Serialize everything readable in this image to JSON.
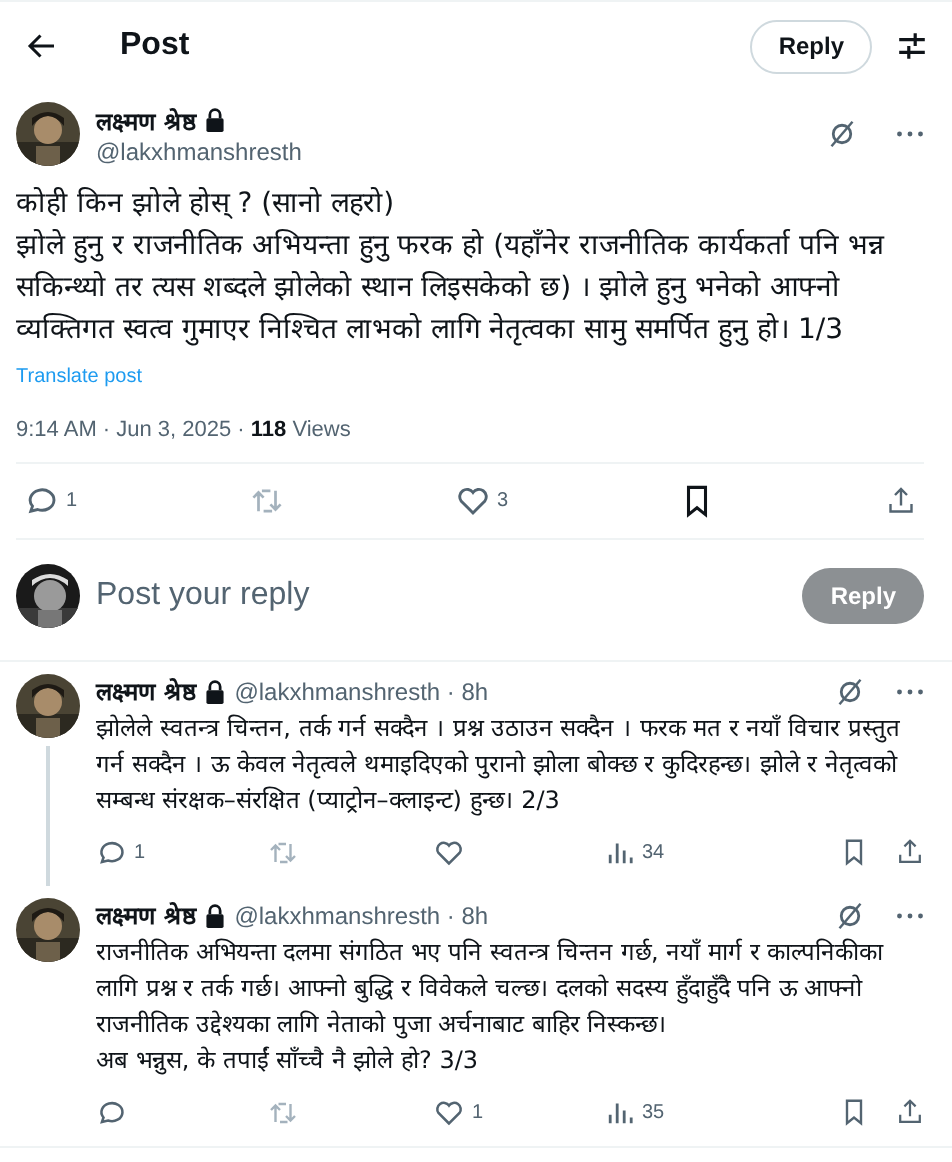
{
  "header": {
    "title": "Post",
    "reply_button": "Reply"
  },
  "post": {
    "author": {
      "name": "लक्ष्मण श्रेष्ठ",
      "handle": "@lakxhmanshresth",
      "locked": true
    },
    "paragraphs": [
      "कोही किन झोले होस् ? (सानो लहरो)",
      "झोले हुनु र राजनीतिक अभियन्ता हुनु फरक हो (यहाँनेर राजनीतिक कार्यकर्ता पनि भन्न सकिन्थ्यो तर त्यस शब्दले झोलेको स्थान लिइसकेको छ) । झोले हुनु भनेको आफ्नो व्यक्तिगत स्वत्व गुमाएर निश्चित लाभको लागि नेतृत्वका सामु समर्पित हुनु हो। 1/3"
    ],
    "translate": "Translate post",
    "time": "9:14 AM · Jun 3, 2025 · ",
    "views_count": "118",
    "views_label": " Views",
    "replies": "1",
    "likes": "3"
  },
  "composer": {
    "placeholder": "Post your reply",
    "button": "Reply"
  },
  "replies": [
    {
      "name": "लक्ष्मण श्रेष्ठ",
      "handle": "@lakxhmanshresth · 8h",
      "locked": true,
      "thread_line": true,
      "paragraphs": [
        "झोलेले स्वतन्त्र चिन्तन, तर्क गर्न सक्दैन । प्रश्न उठाउन सक्दैन । फरक मत र नयाँ विचार प्रस्तुत गर्न सक्दैन । ऊ केवल नेतृत्वले थमाइदिएको पुरानो झोला बोक्छ र कुदिरहन्छ। झोले र नेतृत्वको सम्बन्ध संरक्षक–संरक्षित (प्याट्रोन–क्लाइन्ट) हुन्छ। 2/3"
      ],
      "replies": "1",
      "views": "34"
    },
    {
      "name": "लक्ष्मण श्रेष्ठ",
      "handle": "@lakxhmanshresth · 8h",
      "locked": true,
      "thread_line": false,
      "paragraphs": [
        "राजनीतिक अभियन्ता दलमा संगठित भए पनि स्वतन्त्र चिन्तन गर्छ, नयाँ मार्ग र काल्पनिकीका लागि प्रश्न र तर्क गर्छ। आफ्नो बुद्धि र विवेकले चल्छ। दलको सदस्य हुँदाहुँदै पनि ऊ आफ्नो राजनीतिक उद्देश्यका लागि नेताको पुजा अर्चनाबाट बाहिर निस्कन्छ।",
        "अब भन्नुस, के तपाईं साँच्चै नै झोले हो? 3/3"
      ],
      "likes": "1",
      "views": "35"
    }
  ]
}
